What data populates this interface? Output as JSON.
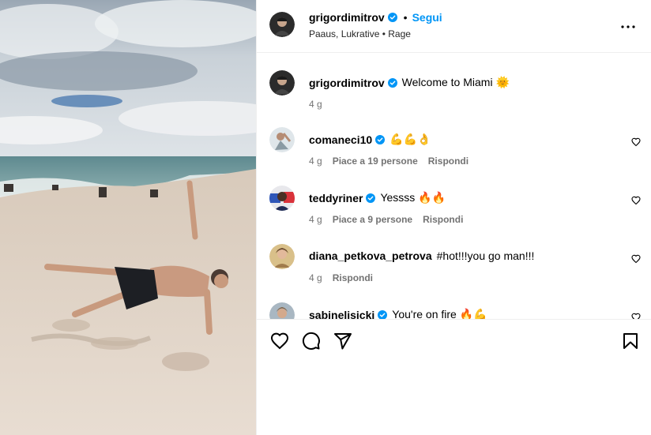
{
  "header": {
    "username": "grigordimitrov",
    "separator": "•",
    "follow_label": "Segui",
    "subtitle": "Paaus, Lukrative • Rage"
  },
  "caption": {
    "username": "grigordimitrov",
    "text": "Welcome to Miami 🌞",
    "time": "4 g"
  },
  "comments": [
    {
      "username": "comaneci10",
      "verified": true,
      "text": "💪💪👌",
      "time": "4 g",
      "likes": "Piace a 19 persone",
      "reply": "Rispondi"
    },
    {
      "username": "teddyriner",
      "verified": true,
      "text": "Yessss 🔥🔥",
      "time": "4 g",
      "likes": "Piace a 9 persone",
      "reply": "Rispondi"
    },
    {
      "username": "diana_petkova_petrova",
      "verified": false,
      "text": "#hot!!!you go man!!!",
      "time": "4 g",
      "likes": "",
      "reply": "Rispondi"
    },
    {
      "username": "sabinelisicki",
      "verified": true,
      "text": "You're on fire 🔥💪",
      "time": "",
      "likes": "",
      "reply": ""
    }
  ],
  "icons": {
    "verified": "verified-badge-icon",
    "more": "more-options-icon",
    "like": "heart-icon",
    "comment": "comment-icon",
    "share": "share-icon",
    "save": "bookmark-icon"
  },
  "colors": {
    "accent": "#0095f6",
    "verified": "#0095f6",
    "muted": "#737373",
    "border": "#efefef"
  }
}
